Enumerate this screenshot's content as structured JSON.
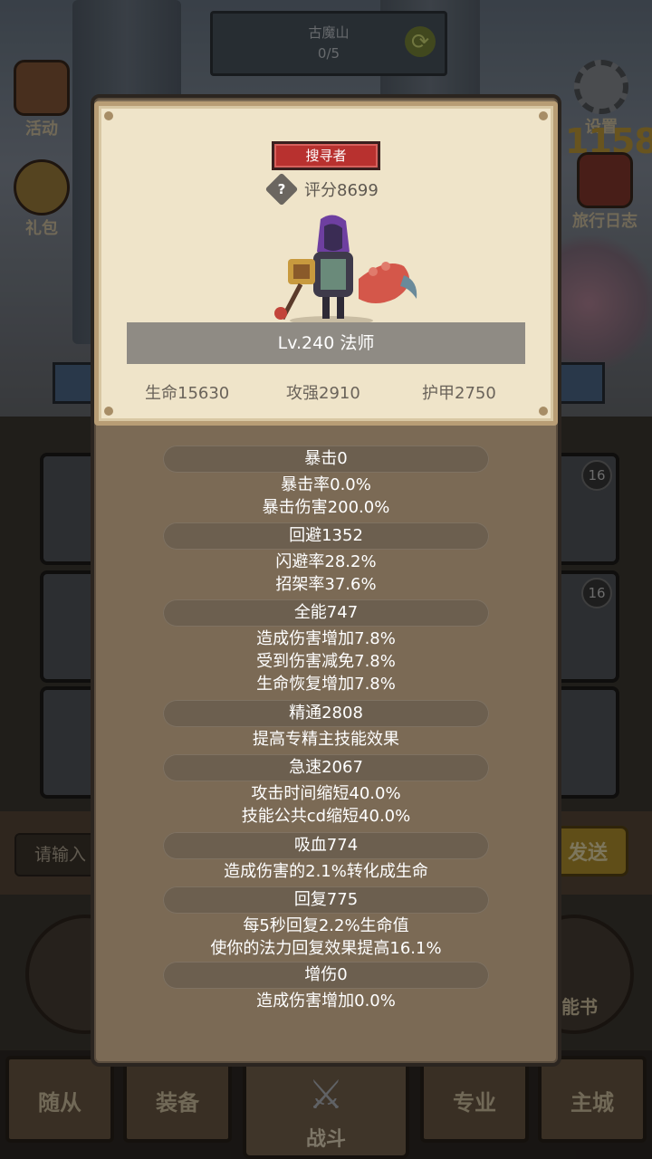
{
  "background": {
    "stage_name": "古魔山",
    "stage_progress": "0/5",
    "left_buttons": [
      "活动",
      "礼包"
    ],
    "settings_label": "设置",
    "journal_label": "旅行日志",
    "big_counter": "1158",
    "slot_levels": [
      "16",
      "16"
    ],
    "input_placeholder": "请输入",
    "send_label": "发送",
    "skill_book_label": "能书",
    "nav": {
      "followers": "随从",
      "equipment": "装备",
      "battle": "战斗",
      "profession": "专业",
      "main_city": "主城"
    }
  },
  "profile": {
    "role_badge": "搜寻者",
    "score": "评分8699",
    "level_class": "Lv.240 法师",
    "hp": "生命15630",
    "attack": "攻强2910",
    "armor": "护甲2750"
  },
  "stats": [
    {
      "title": "暴击0",
      "lines": [
        "暴击率0.0%",
        "暴击伤害200.0%"
      ]
    },
    {
      "title": "回避1352",
      "lines": [
        "闪避率28.2%",
        "招架率37.6%"
      ]
    },
    {
      "title": "全能747",
      "lines": [
        "造成伤害增加7.8%",
        "受到伤害减免7.8%",
        "生命恢复增加7.8%"
      ]
    },
    {
      "title": "精通2808",
      "lines": [
        "提高专精主技能效果"
      ]
    },
    {
      "title": "急速2067",
      "lines": [
        "攻击时间缩短40.0%",
        "技能公共cd缩短40.0%"
      ]
    },
    {
      "title": "吸血774",
      "lines": [
        "造成伤害的2.1%转化成生命"
      ]
    },
    {
      "title": "回复775",
      "lines": [
        "每5秒回复2.2%生命值",
        "使你的法力回复效果提高16.1%"
      ]
    },
    {
      "title": "增伤0",
      "lines": [
        "造成伤害增加0.0%"
      ]
    }
  ],
  "colors": {
    "badge": "#b8312f",
    "card": "#efe4c9",
    "panel": "#7b6a55",
    "pill": "#6c5f4f"
  }
}
